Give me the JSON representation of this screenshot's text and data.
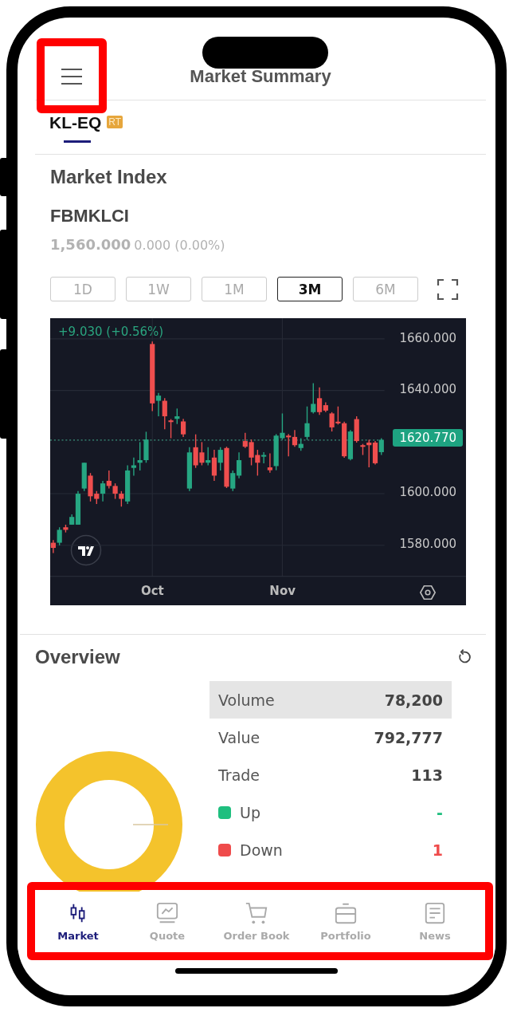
{
  "header": {
    "title": "Market Summary",
    "menu_highlighted": true
  },
  "exchange_tabs": [
    {
      "label": "KL-EQ",
      "badge": "RT",
      "selected": true
    }
  ],
  "market_index": {
    "title": "Market Index",
    "symbol": "FBMKLCI",
    "price": "1,560.000",
    "change": "0.000 (0.00%)"
  },
  "periods": [
    {
      "label": "1D",
      "selected": false
    },
    {
      "label": "1W",
      "selected": false
    },
    {
      "label": "1M",
      "selected": false
    },
    {
      "label": "3M",
      "selected": true
    },
    {
      "label": "6M",
      "selected": false
    }
  ],
  "chart": {
    "change": "+9.030 (+0.56%)",
    "chart_data": {
      "type": "candlestick",
      "ylim": [
        1568,
        1668
      ],
      "grid": true,
      "ref_lines": [
        {
          "axis": "y",
          "value": 1620.77,
          "label": "1620.770",
          "color": "#3a8f7a"
        }
      ],
      "categories": [
        null,
        null,
        null,
        null,
        null,
        null,
        null,
        null,
        null,
        null,
        null,
        null,
        null,
        null,
        null,
        null,
        "Oct",
        null,
        null,
        null,
        null,
        null,
        null,
        null,
        null,
        null,
        null,
        null,
        null,
        null,
        null,
        null,
        null,
        null,
        null,
        null,
        null,
        "Nov",
        null,
        null,
        null,
        null,
        null,
        null,
        null,
        null,
        null,
        null,
        null,
        null,
        null,
        null,
        null,
        null
      ],
      "ohlc": [
        [
          1581,
          1582,
          1577,
          1579
        ],
        [
          1581,
          1587,
          1580,
          1586
        ],
        [
          1587,
          1588,
          1585,
          1586
        ],
        [
          1588,
          1592,
          1588,
          1591
        ],
        [
          1588,
          1601,
          1588,
          1600
        ],
        [
          1602,
          1612,
          1601,
          1612
        ],
        [
          1607,
          1608,
          1597,
          1599
        ],
        [
          1600,
          1601,
          1596,
          1598
        ],
        [
          1600,
          1605,
          1597,
          1604
        ],
        [
          1605,
          1609,
          1602,
          1603
        ],
        [
          1603,
          1604,
          1598,
          1600
        ],
        [
          1600,
          1601,
          1595,
          1598
        ],
        [
          1597,
          1611,
          1596,
          1609
        ],
        [
          1610,
          1614,
          1607,
          1611
        ],
        [
          1612,
          1620,
          1609,
          1613
        ],
        [
          1613,
          1624,
          1612,
          1621
        ],
        [
          1658,
          1659,
          1632,
          1635
        ],
        [
          1636,
          1639,
          1630,
          1638
        ],
        [
          1636,
          1637,
          1625,
          1630
        ],
        [
          1628.4,
          1628.9,
          1621.5,
          1627.9
        ],
        [
          1629,
          1633,
          1627,
          1630
        ],
        [
          1628,
          1629,
          1622,
          1623
        ],
        [
          1602,
          1618,
          1601,
          1616
        ],
        [
          1618,
          1623,
          1610,
          1611
        ],
        [
          1616,
          1620,
          1611,
          1612
        ],
        [
          1612,
          1618,
          1611,
          1613
        ],
        [
          1614,
          1617,
          1605,
          1607
        ],
        [
          1612,
          1618,
          1609,
          1617
        ],
        [
          1617.7,
          1618.2,
          1602.2,
          1602.7
        ],
        [
          1602,
          1609,
          1601,
          1608
        ],
        [
          1607,
          1616,
          1606,
          1613
        ],
        [
          1620.4,
          1623.6,
          1617.7,
          1618.2
        ],
        [
          1620,
          1621,
          1611,
          1614
        ],
        [
          1615,
          1617,
          1607,
          1612
        ],
        [
          1614.5,
          1616.1,
          1611.8,
          1615
        ],
        [
          1610.2,
          1615.6,
          1608.1,
          1609.1
        ],
        [
          1610.7,
          1623.1,
          1609.1,
          1622.5
        ],
        [
          1621.5,
          1631.1,
          1620.9,
          1623.6
        ],
        [
          1622.5,
          1623.1,
          1614.5,
          1622
        ],
        [
          1622,
          1624.7,
          1618.2,
          1618.8
        ],
        [
          1617.7,
          1621.5,
          1616.6,
          1619.3
        ],
        [
          1622,
          1633.8,
          1620.9,
          1627.3
        ],
        [
          1631.6,
          1642.8,
          1631.1,
          1634.8
        ],
        [
          1637,
          1641.2,
          1630.5,
          1631.6
        ],
        [
          1634.3,
          1635.4,
          1631.6,
          1632.2
        ],
        [
          1631.1,
          1631.6,
          1624.1,
          1625.7
        ],
        [
          1627.9,
          1633.8,
          1626.8,
          1627.3
        ],
        [
          1627.3,
          1627.9,
          1613.9,
          1614.5
        ],
        [
          1613.4,
          1624.7,
          1612.9,
          1624.1
        ],
        [
          1628.9,
          1630,
          1619.8,
          1620.4
        ],
        [
          1618.8,
          1619.3,
          1615,
          1618.2
        ],
        [
          1619.8,
          1620.9,
          1610.2,
          1618.8
        ],
        [
          1619.8,
          1620.4,
          1611.3,
          1611.8
        ],
        [
          1616.1,
          1621.5,
          1615,
          1620.9
        ]
      ],
      "yticks": [
        {
          "value": 1660,
          "label": "1660.000"
        },
        {
          "value": 1640,
          "label": "1640.000"
        },
        {
          "value": 1600,
          "label": "1600.000"
        },
        {
          "value": 1580,
          "label": "1580.000"
        }
      ]
    }
  },
  "overview": {
    "title": "Overview",
    "rows": [
      {
        "kind": "stat",
        "label": "Volume",
        "value": "78,200",
        "selected": true
      },
      {
        "kind": "stat",
        "label": "Value",
        "value": "792,777",
        "selected": false
      },
      {
        "kind": "stat",
        "label": "Trade",
        "value": "113",
        "selected": false
      },
      {
        "kind": "legend",
        "label": "Up",
        "value": "-",
        "color": "#1fbf7f"
      },
      {
        "kind": "legend",
        "label": "Down",
        "value": "1",
        "color": "#ef4b4b"
      }
    ]
  },
  "tab_bar": {
    "highlighted": true,
    "items": [
      {
        "label": "Market",
        "selected": true
      },
      {
        "label": "Quote",
        "selected": false
      },
      {
        "label": "Order Book",
        "selected": false
      },
      {
        "label": "Portfolio",
        "selected": false
      },
      {
        "label": "News",
        "selected": false
      }
    ]
  }
}
